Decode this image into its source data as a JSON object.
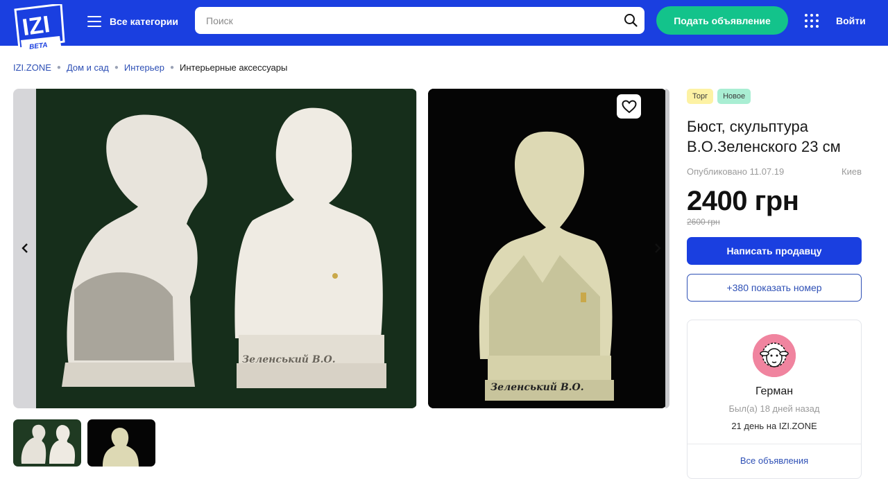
{
  "header": {
    "logo_text": "IZI",
    "logo_sub": "BETA",
    "categories_label": "Все категории",
    "search_placeholder": "Поиск",
    "post_ad_label": "Подать объявление",
    "login_label": "Войти",
    "accent_color": "#1a3fe0",
    "cta_color": "#13c38b"
  },
  "breadcrumb": [
    {
      "label": "IZI.ZONE"
    },
    {
      "label": "Дом и сад"
    },
    {
      "label": "Интерьер"
    },
    {
      "label": "Интерьерные аксессуары"
    }
  ],
  "gallery": {
    "slide1_caption": "Зеленський В.О.",
    "slide2_caption": "Зеленський В.О."
  },
  "listing": {
    "tags": [
      "Торг",
      "Новое"
    ],
    "title": "Бюст, скульптура В.О.Зеленского 23 см",
    "published": "Опубликовано 11.07.19",
    "city": "Киев",
    "price": "2400 грн",
    "old_price": "2600 грн",
    "write_seller_label": "Написать продавцу",
    "show_phone_label": "+380 показать номер"
  },
  "seller": {
    "name": "Герман",
    "last_seen": "Был(а) 18 дней назад",
    "days_on_site": "21 день на IZI.ZONE",
    "all_ads_label": "Все объявления"
  }
}
